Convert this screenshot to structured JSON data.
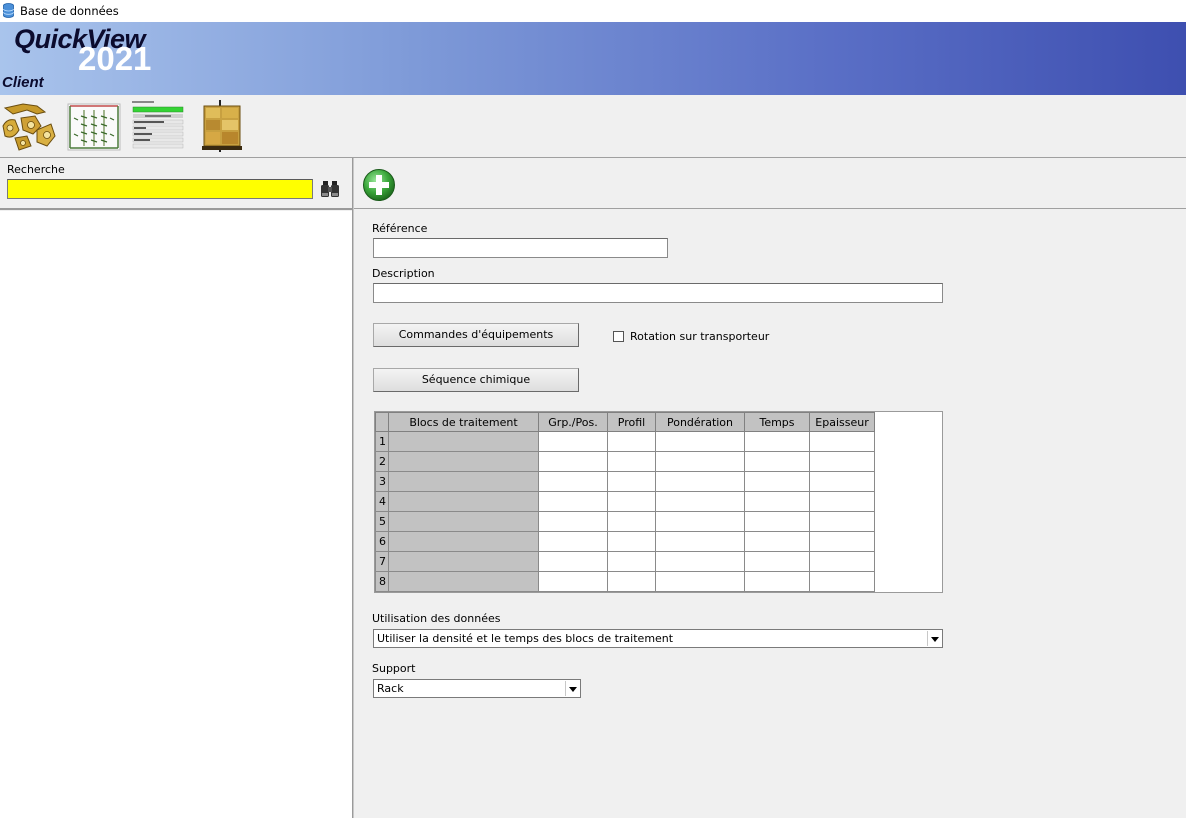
{
  "window": {
    "title": "Base de données"
  },
  "banner": {
    "brand": "QuickView",
    "year": "2021",
    "module": "Client"
  },
  "search": {
    "label": "Recherche",
    "value": ""
  },
  "form": {
    "reference_label": "Référence",
    "reference_value": "",
    "description_label": "Description",
    "description_value": "",
    "equipment_button": "Commandes d'équipements",
    "chemical_button": "Séquence chimique",
    "rotation_label": "Rotation sur transporteur",
    "rotation_checked": false
  },
  "grid": {
    "columns": [
      "Blocs de traitement",
      "Grp./Pos.",
      "Profil",
      "Pondération",
      "Temps",
      "Epaisseur"
    ],
    "rows": [
      "1",
      "2",
      "3",
      "4",
      "5",
      "6",
      "7",
      "8"
    ]
  },
  "data_usage": {
    "label": "Utilisation des données",
    "selected": "Utiliser la densité et le temps des blocs de traitement"
  },
  "support": {
    "label": "Support",
    "selected": "Rack"
  },
  "colors": {
    "search_bg": "#ffff00",
    "banner_start": "#a9c4ec",
    "banner_end": "#3e4fb0",
    "add_green": "#3aa63a"
  },
  "icons": {
    "toolbar": [
      "parts-icon",
      "rack-icon",
      "program-list-icon",
      "product-bundle-icon"
    ],
    "search": "binoculars-icon",
    "add": "add-plus-icon"
  }
}
